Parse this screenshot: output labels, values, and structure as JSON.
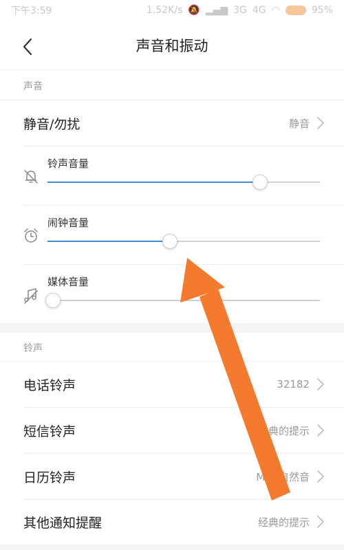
{
  "status_bar": {
    "time": "下午3:59",
    "network_speed": "1.52K/s",
    "signal_1": "3G",
    "signal_2": "4G",
    "battery": "95%"
  },
  "header": {
    "title": "声音和振动"
  },
  "sections": {
    "sound": {
      "title": "声音",
      "silent_row": {
        "label": "静音/勿扰",
        "value": "静音"
      },
      "volumes": [
        {
          "label": "铃声音量",
          "level": 0.78,
          "icon": "bell-muted-icon"
        },
        {
          "label": "闹钟音量",
          "level": 0.45,
          "icon": "alarm-clock-icon"
        },
        {
          "label": "媒体音量",
          "level": 0.02,
          "icon": "music-note-icon"
        }
      ]
    },
    "ringtone": {
      "title": "铃声",
      "items": [
        {
          "label": "电话铃声",
          "value": "32182"
        },
        {
          "label": "短信铃声",
          "value": "经典的提示"
        },
        {
          "label": "日历铃声",
          "value": "MIUI自然音"
        },
        {
          "label": "其他通知提醒",
          "value": "经典的提示"
        }
      ]
    }
  },
  "colors": {
    "accent": "#3a8fd6",
    "annotation_arrow": "#f47b2e"
  }
}
